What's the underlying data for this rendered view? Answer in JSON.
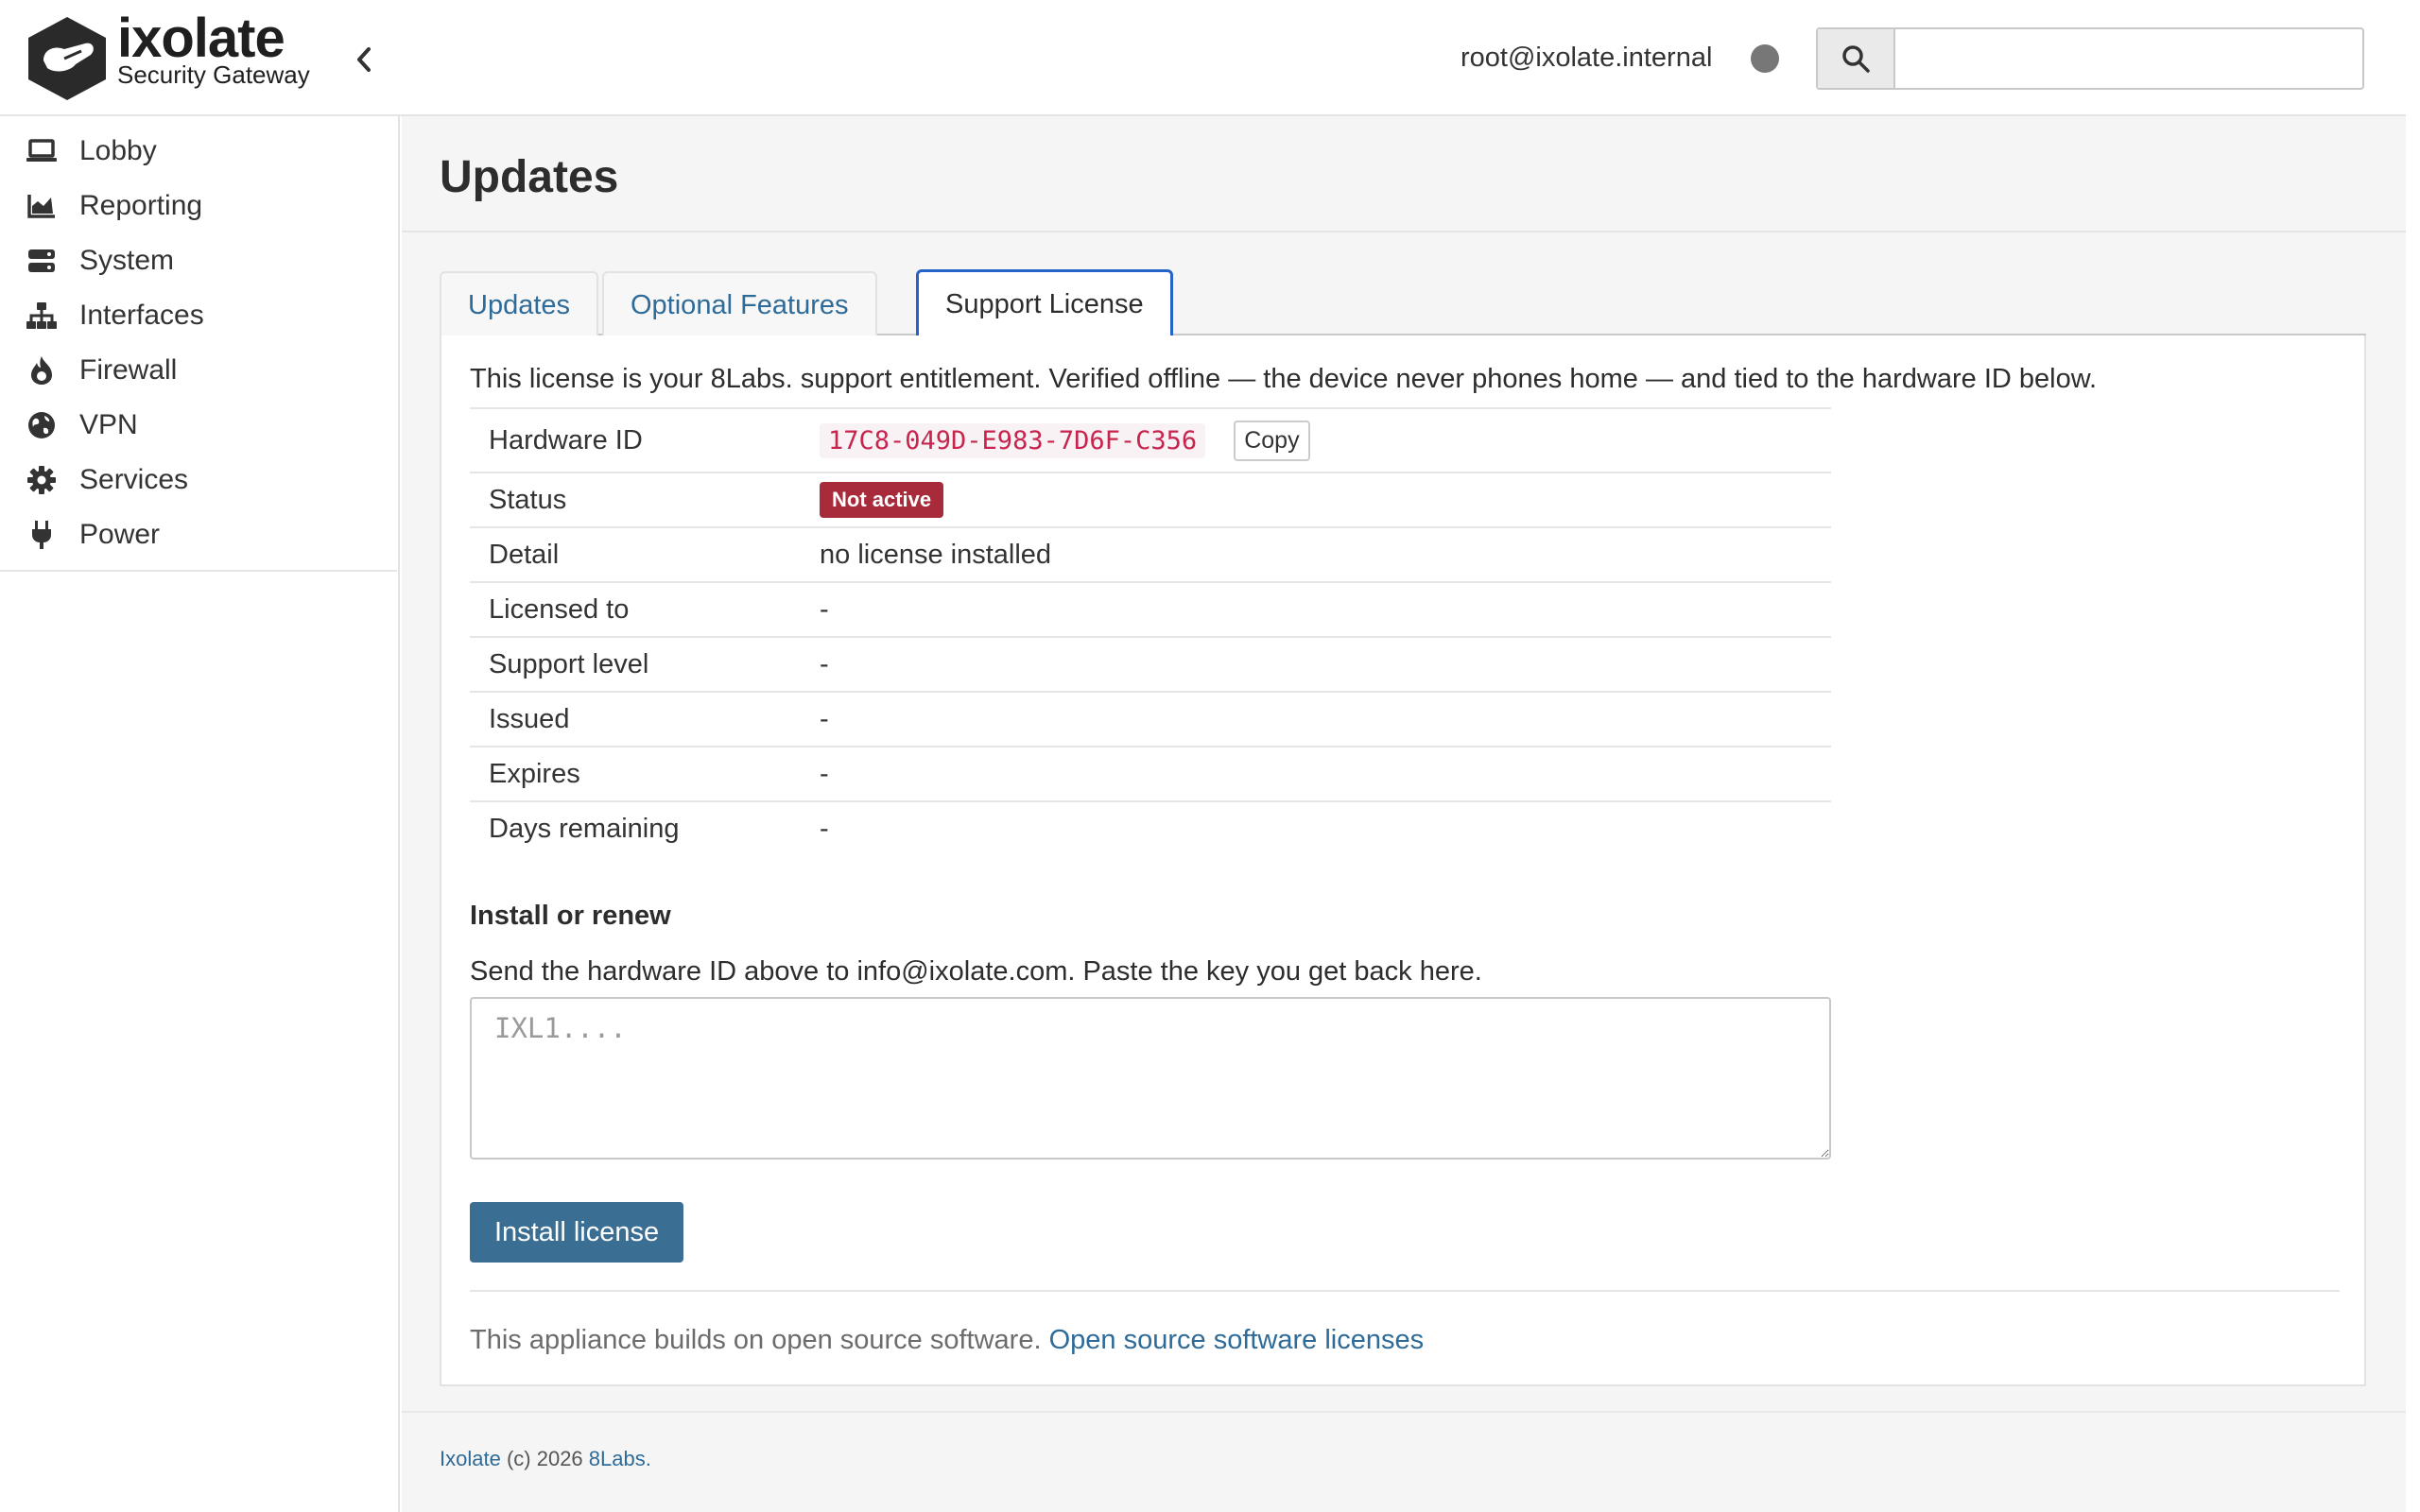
{
  "header": {
    "brand_name": "ixolate",
    "brand_sub": "Security Gateway",
    "user": "root@ixolate.internal",
    "search_placeholder": ""
  },
  "sidebar": {
    "items": [
      {
        "label": "Lobby",
        "icon": "laptop-icon"
      },
      {
        "label": "Reporting",
        "icon": "area-chart-icon"
      },
      {
        "label": "System",
        "icon": "server-icon"
      },
      {
        "label": "Interfaces",
        "icon": "network-icon"
      },
      {
        "label": "Firewall",
        "icon": "fire-icon"
      },
      {
        "label": "VPN",
        "icon": "globe-icon"
      },
      {
        "label": "Services",
        "icon": "gear-icon"
      },
      {
        "label": "Power",
        "icon": "plug-icon"
      }
    ]
  },
  "page": {
    "title": "Updates",
    "tabs": [
      {
        "label": "Updates",
        "active": false
      },
      {
        "label": "Optional Features",
        "active": false
      },
      {
        "label": "Support License",
        "active": true
      }
    ]
  },
  "license": {
    "intro": "This license is your 8Labs. support entitlement. Verified offline — the device never phones home — and tied to the hardware ID below.",
    "rows": {
      "hardware_id": {
        "label": "Hardware ID",
        "value": "17C8-049D-E983-7D6F-C356",
        "copy_label": "Copy"
      },
      "status": {
        "label": "Status",
        "value": "Not active"
      },
      "detail": {
        "label": "Detail",
        "value": "no license installed"
      },
      "licensed_to": {
        "label": "Licensed to",
        "value": "-"
      },
      "support_level": {
        "label": "Support level",
        "value": "-"
      },
      "issued": {
        "label": "Issued",
        "value": "-"
      },
      "expires": {
        "label": "Expires",
        "value": "-"
      },
      "days_remaining": {
        "label": "Days remaining",
        "value": "-"
      }
    },
    "install_title": "Install or renew",
    "install_help": "Send the hardware ID above to info@ixolate.com. Paste the key you get back here.",
    "key_placeholder": "IXL1....",
    "install_button": "Install license",
    "oss_text": "This appliance builds on open source software.",
    "oss_link": "Open source software licenses"
  },
  "footer": {
    "brand_link": "Ixolate",
    "copyright": "(c) 2026",
    "company_link": "8Labs.",
    "status_badge_color": "#a72b3a",
    "accent_color": "#3b6e93"
  }
}
